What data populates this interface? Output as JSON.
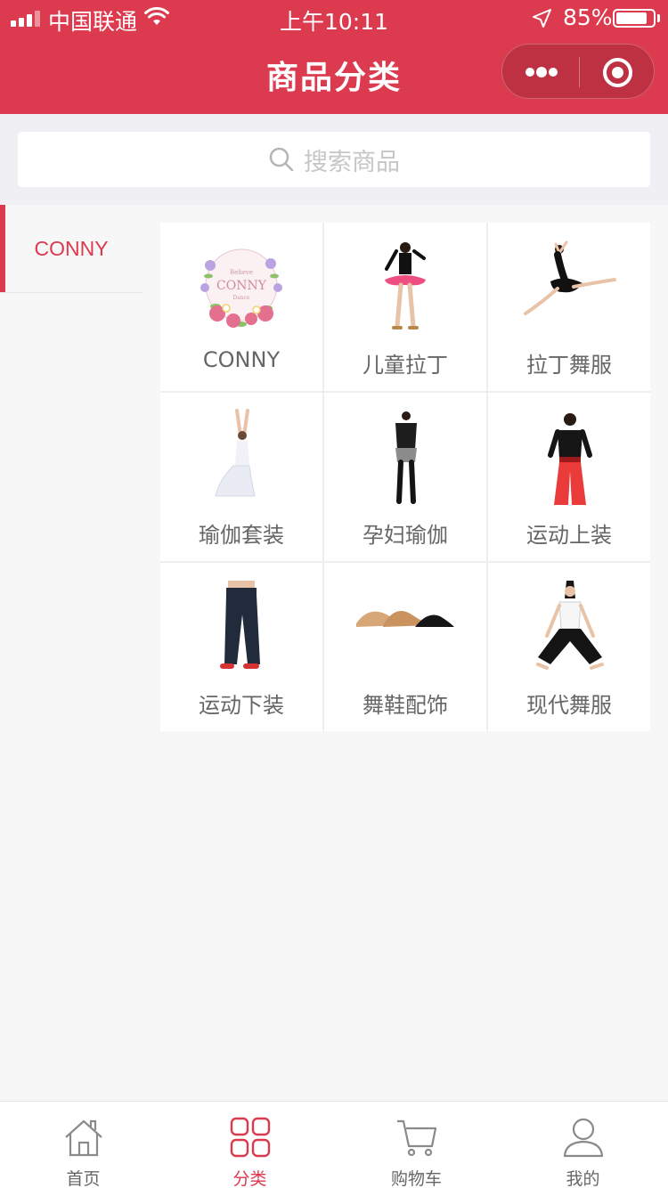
{
  "status_bar": {
    "carrier": "中国联通",
    "time": "上午10:11",
    "battery": "85%",
    "battery_level": 0.85
  },
  "nav": {
    "title": "商品分类"
  },
  "search": {
    "placeholder": "搜索商品"
  },
  "sidebar": {
    "items": [
      {
        "label": "CONNY",
        "active": true
      }
    ]
  },
  "categories": [
    {
      "label": "CONNY",
      "icon": "conny-logo-image"
    },
    {
      "label": "儿童拉丁",
      "icon": "kids-latin-dance-image"
    },
    {
      "label": "拉丁舞服",
      "icon": "latin-dancewear-image"
    },
    {
      "label": "瑜伽套装",
      "icon": "yoga-set-image"
    },
    {
      "label": "孕妇瑜伽",
      "icon": "maternity-yoga-image"
    },
    {
      "label": "运动上装",
      "icon": "sports-top-image"
    },
    {
      "label": "运动下装",
      "icon": "sports-pants-image"
    },
    {
      "label": "舞鞋配饰",
      "icon": "dance-shoes-image"
    },
    {
      "label": "现代舞服",
      "icon": "modern-dancewear-image"
    }
  ],
  "tabbar": {
    "items": [
      {
        "label": "首页",
        "icon": "home-icon"
      },
      {
        "label": "分类",
        "icon": "category-icon",
        "active": true
      },
      {
        "label": "购物车",
        "icon": "cart-icon"
      },
      {
        "label": "我的",
        "icon": "user-icon"
      }
    ]
  },
  "colors": {
    "accent": "#dc3a4e",
    "background": "#f7f7f7"
  }
}
